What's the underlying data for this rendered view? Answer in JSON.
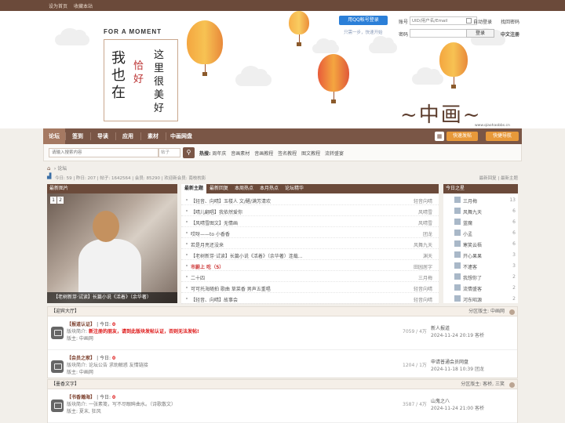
{
  "topbar": {
    "set_home": "设为首页",
    "bookmark": "收藏本站"
  },
  "banner": {
    "slogan_en": "FOR A MOMENT",
    "slogan_col1": "我也在",
    "slogan_col2": "恰好",
    "slogan_col3": "这里很美好",
    "site_domain": "www.qiaohaobbs.cn"
  },
  "login": {
    "qq_button": "用QQ帐号登录",
    "qq_tip": "只需一步，快速开始",
    "account_label": "账号",
    "account_placeholder": "UID/用户名/Email",
    "password_label": "密码",
    "auto_login": "自动登录",
    "forgot": "找回密码",
    "login_button": "登录",
    "register": "中文注册"
  },
  "nav": {
    "items": [
      "论坛",
      "签到",
      "导读",
      "应用",
      "素材",
      "中画网盘"
    ],
    "quick_post": "快速发帖",
    "quick_nav": "快捷导航"
  },
  "search": {
    "placeholder": "请输入搜索内容",
    "type": "帖子",
    "hot_label": "热搜:",
    "hot_terms": [
      "周年庆",
      "音画素材",
      "音画教程",
      "签名教程",
      "图文教程",
      "流转盛宴"
    ]
  },
  "crumb": {
    "current": "论坛"
  },
  "stats": {
    "text": "今日: 59 | 昨日: 207 | 帖子: 1642564 | 会员: 85290 | 欢迎新会员: 南枝枕影",
    "latest_reply": "最新回复",
    "latest_thread": "最新主题"
  },
  "picture": {
    "title": "最新图片",
    "caption": "【老树新芽·试读】长篇小说《活着》（余华著）",
    "pages": [
      "1",
      "2"
    ]
  },
  "tabs": [
    "最新主题",
    "最新回复",
    "本周热点",
    "本月热点",
    "论坛精华"
  ],
  "threads": [
    {
      "title": "【轻音、向晴】玉楼人 文/醒/满芳清欢",
      "author": "轻音向晴",
      "red": false
    },
    {
      "title": "【晴儿翻唱】我依然爱你",
      "author": "风晴雪",
      "red": false
    },
    {
      "title": "【风晴雪图文】无情画",
      "author": "风晴雪",
      "red": false
    },
    {
      "title": "哎呀——to 小香香",
      "author": "团龙",
      "red": false
    },
    {
      "title": "若是月亮还没来",
      "author": "风舞九天",
      "red": false
    },
    {
      "title": "【老树新芽·试读】长篇小说《活着》（余华著）连载...",
      "author": "渊天",
      "red": false
    },
    {
      "title": "市蔚上 吃（5）",
      "author": "田园居字",
      "red": true
    },
    {
      "title": "二十四",
      "author": "三月梅",
      "red": false
    },
    {
      "title": "可可托海随拍 歌曲 草菜香 男声五重唱",
      "author": "轻音向晴",
      "red": false
    },
    {
      "title": "【轻音、向晴】故事会",
      "author": "轻音向晴",
      "red": false
    }
  ],
  "stars": {
    "title": "今日之星",
    "list": [
      {
        "name": "三月梅",
        "count": "13"
      },
      {
        "name": "风舞九天",
        "count": "6"
      },
      {
        "name": "蓝魔",
        "count": "6"
      },
      {
        "name": "小孟",
        "count": "6"
      },
      {
        "name": "寒笑云梧",
        "count": "6"
      },
      {
        "name": "开心果果",
        "count": "3"
      },
      {
        "name": "不逮客",
        "count": "3"
      },
      {
        "name": "我想你了",
        "count": "2"
      },
      {
        "name": "流情盛客",
        "count": "2"
      },
      {
        "name": "河东昭源",
        "count": "2"
      }
    ]
  },
  "sections": [
    {
      "name": "迎宾大厅",
      "moderator": "分区版主: 中画网",
      "forums": [
        {
          "name": "【报道认证】",
          "today": "今日: ",
          "today_n": "0",
          "desc_prefix": "版块简介: ",
          "desc_red": "新注册的朋友，请到此版块发帖认证，否则无法发帖!",
          "desc_rest": "",
          "mods": "版主: 中画网",
          "counts": "7059 / 4万",
          "last_title": "新人报道",
          "last_meta": "2024-11-24 20:19 客桥"
        },
        {
          "name": "【会员之家】",
          "today": "今日: ",
          "today_n": "0",
          "desc_prefix": "版块简介: ",
          "desc_red": "",
          "desc_rest": "论坛公告 求助解惑 友情链接",
          "mods": "版主: 中画网",
          "counts": "1204 / 1万",
          "last_title": "申请普通会员网盘",
          "last_meta": "2024-11-18 10:39 团龙"
        }
      ]
    },
    {
      "name": "墨香文字",
      "moderator": "分区版主: 客桥, 三笑",
      "forums": [
        {
          "name": "【书香瀚海】",
          "today": "今日: ",
          "today_n": "0",
          "desc_prefix": "版块简介: ",
          "desc_red": "",
          "desc_rest": "一张素笺，写不尽眼眸曲水。（诗歌散文）",
          "mods": "版主: 夏末, 狂风",
          "counts": "3587 / 4万",
          "last_title": "山鬼之八",
          "last_meta": "2024-11-24 21:00 客桥"
        }
      ]
    }
  ],
  "colors": {
    "nav": "#7a5646",
    "accent": "#e8993a",
    "header": "#6b4a3a"
  }
}
